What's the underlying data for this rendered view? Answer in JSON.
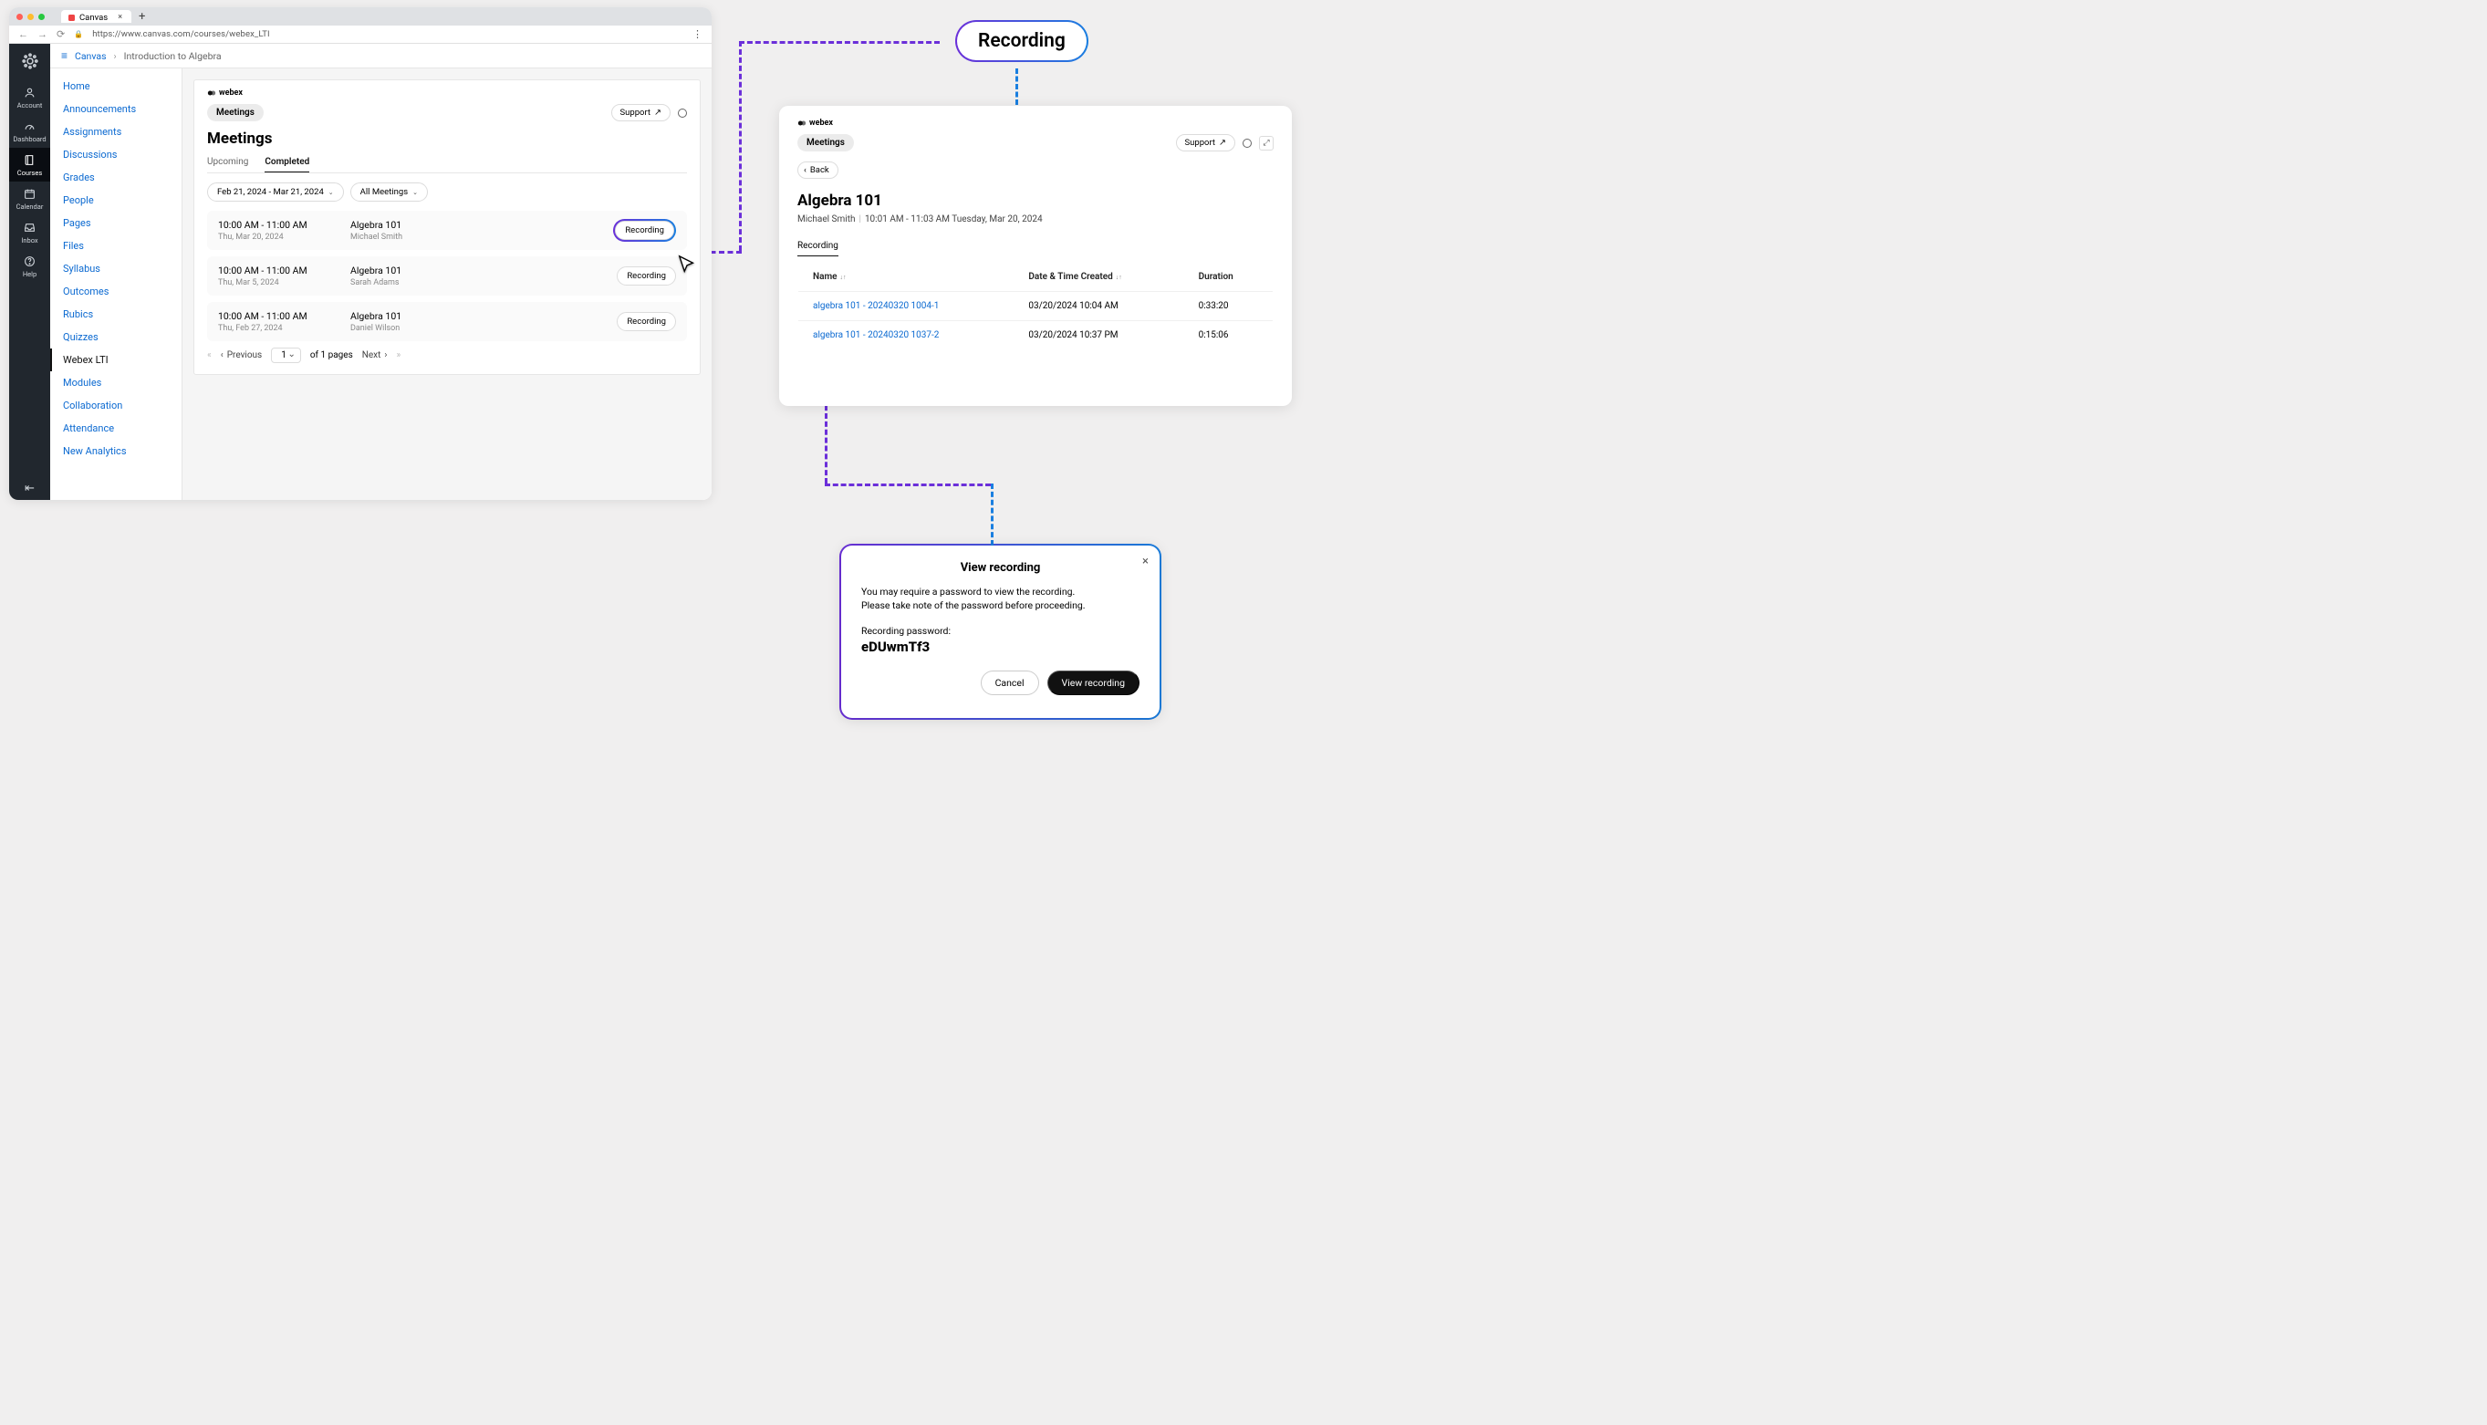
{
  "callout": {
    "label": "Recording"
  },
  "browser": {
    "tab_title": "Canvas",
    "url": "https://www.canvas.com/courses/webex_LTI"
  },
  "rail": {
    "items": [
      {
        "label": "Account"
      },
      {
        "label": "Dashboard"
      },
      {
        "label": "Courses"
      },
      {
        "label": "Calendar"
      },
      {
        "label": "Inbox"
      },
      {
        "label": "Help"
      }
    ]
  },
  "breadcrumb": {
    "root": "Canvas",
    "current": "Introduction to Algebra"
  },
  "course_menu": [
    "Home",
    "Announcements",
    "Assignments",
    "Discussions",
    "Grades",
    "People",
    "Pages",
    "Files",
    "Syllabus",
    "Outcomes",
    "Rubics",
    "Quizzes",
    "Webex LTI",
    "Modules",
    "Collaboration",
    "Attendance",
    "New Analytics"
  ],
  "course_menu_selected_index": 12,
  "webex": {
    "brand": "webex",
    "pill": "Meetings",
    "support": "Support",
    "heading": "Meetings",
    "tabs": {
      "upcoming": "Upcoming",
      "completed": "Completed"
    },
    "filters": {
      "range": "Feb 21, 2024 - Mar 21, 2024",
      "scope": "All Meetings"
    },
    "rows": [
      {
        "time": "10:00 AM - 11:00 AM",
        "date": "Thu, Mar 20, 2024",
        "title": "Algebra 101",
        "host": "Michael Smith",
        "action": "Recording"
      },
      {
        "time": "10:00 AM - 11:00 AM",
        "date": "Thu, Mar 5, 2024",
        "title": "Algebra 101",
        "host": "Sarah Adams",
        "action": "Recording"
      },
      {
        "time": "10:00 AM - 11:00 AM",
        "date": "Thu, Feb 27, 2024",
        "title": "Algebra 101",
        "host": "Daniel Wilson",
        "action": "Recording"
      }
    ],
    "pager": {
      "prev": "Previous",
      "current": "1",
      "of": "of 1 pages",
      "next": "Next"
    }
  },
  "panel2": {
    "brand": "webex",
    "pill": "Meetings",
    "support": "Support",
    "back": "Back",
    "heading": "Algebra 101",
    "sub_host": "Michael Smith",
    "sub_time": "10:01 AM - 11:03 AM Tuesday, Mar 20, 2024",
    "tab": "Recording",
    "columns": {
      "name": "Name",
      "created": "Date & Time Created",
      "duration": "Duration"
    },
    "rows": [
      {
        "name": "algebra 101 - 20240320 1004-1",
        "created": "03/20/2024 10:04 AM",
        "duration": "0:33:20"
      },
      {
        "name": "algebra 101 - 20240320 1037-2",
        "created": "03/20/2024 10:37 PM",
        "duration": "0:15:06"
      }
    ]
  },
  "modal": {
    "title": "View recording",
    "body1": "You may require a password to view the recording.",
    "body2": "Please take note of the password before proceeding.",
    "pw_label": "Recording password:",
    "pw": "eDUwmTf3",
    "cancel": "Cancel",
    "view": "View recording"
  }
}
